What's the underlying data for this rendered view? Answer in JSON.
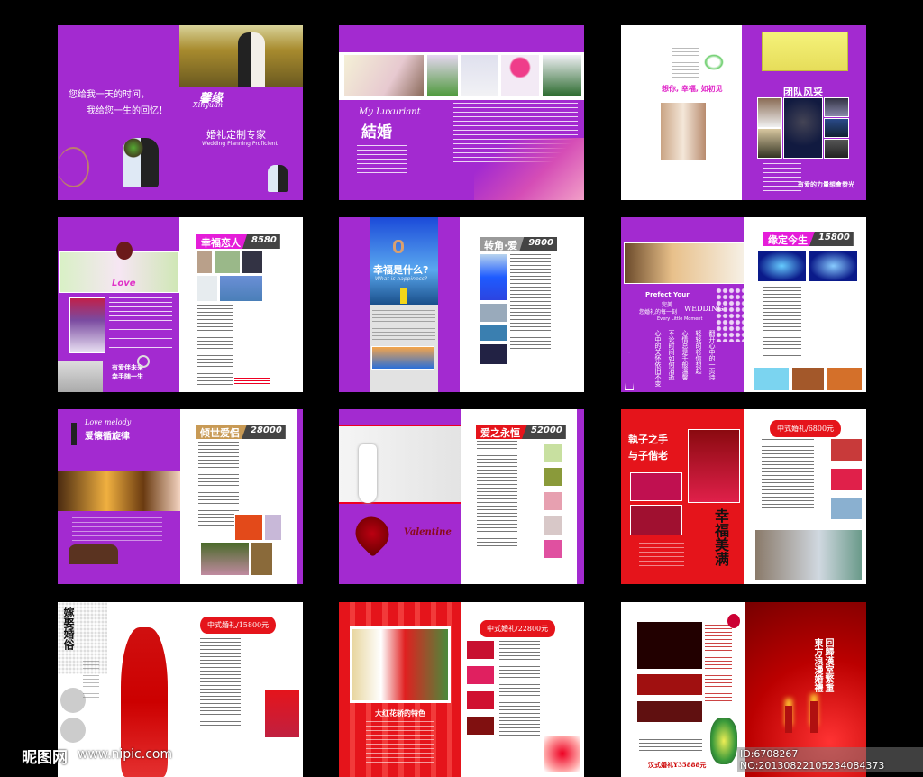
{
  "spreads": {
    "s1": {
      "slogan1": "您给我一天的时间，",
      "slogan2": "我给您一生的回忆！",
      "logo_cn": "馨缘",
      "logo_en": "Xinyuan",
      "title": "婚礼定制专家",
      "subtitle": "Wedding Planning Proficient"
    },
    "s2": {
      "script": "My Luxuriant",
      "title": "結婚"
    },
    "s3": {
      "heading_left": "想你, 幸福, 如初见",
      "heading_right": "团队风采",
      "footer": "有爱的力量想會發光"
    },
    "s4": {
      "tag": "幸福恋人",
      "price": "8580",
      "love": "Love",
      "caption1": "有爱伴未来",
      "caption2": "幸手随一生"
    },
    "s5": {
      "tag": "转角·爱",
      "price": "9800",
      "question": "幸福是什么?",
      "question_en": "What is happiness?"
    },
    "s6": {
      "tag": "缘定今生",
      "price": "15800",
      "line1": "Prefect Your",
      "line2": "完美",
      "line3": "您婚礼的每一刻",
      "line4": "WEDDING",
      "line5": "Every Little Moment",
      "verses": [
        "翻开心中的一页诗",
        "轻轻的将你想起",
        "心情总是千般温馨",
        "不论时间如何消逝",
        "心中的关怀依旧不变"
      ]
    },
    "s7": {
      "tag": "倾世爱侣",
      "price": "28000",
      "script": "Love melody",
      "title": "爱懐循旋律"
    },
    "s8": {
      "tag": "爱之永恒",
      "price": "52000",
      "script": "Valentine"
    },
    "s9": {
      "calligraphy1": "執子之手",
      "calligraphy2": "与子偕老",
      "calligraphy3": "幸福美满",
      "banner": "中式婚礼/6800元"
    },
    "s10": {
      "calligraphy": "嫁娶婚俗",
      "banner": "中式婚礼/15800元"
    },
    "s11": {
      "caption": "大红花轿的特色",
      "banner": "中式婚礼/22800元"
    },
    "s12": {
      "price_label": "汉式婚礼Y35888元",
      "vertical1": "回歸漢室繁重",
      "vertical2": "東方浪漫婚禮"
    }
  },
  "watermark": {
    "site_cn": "昵图网",
    "site_url": "www.nipic.com",
    "id_text": "ID:6708267 NO:20130822105234084373"
  }
}
